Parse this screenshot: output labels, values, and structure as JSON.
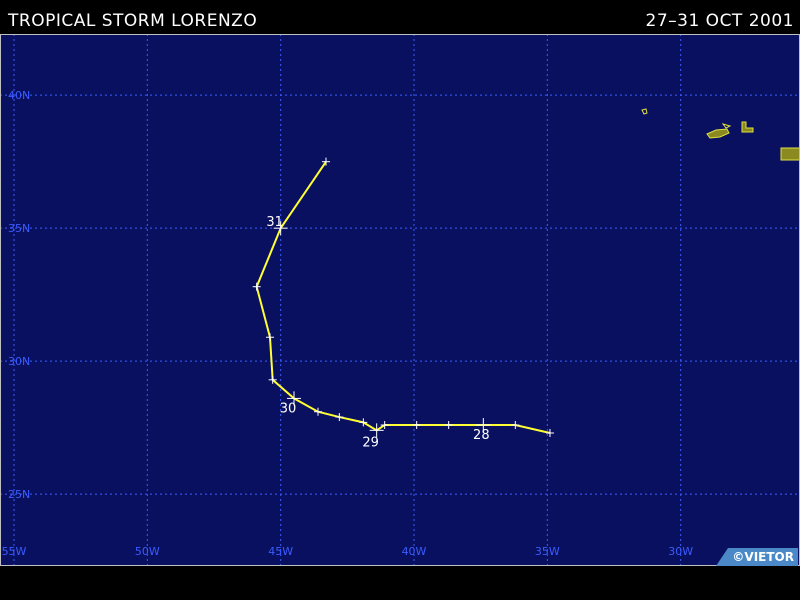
{
  "header": {
    "storm_name": "TROPICAL STORM LORENZO",
    "date_range": "27–31 OCT 2001"
  },
  "map": {
    "projection": "lat-lon",
    "lon_range": [
      -55,
      -25
    ],
    "lat_range": [
      22.3,
      42.3
    ],
    "background_color": "#0a1060",
    "grid_color": "#3a5cff",
    "track_color": "#ffff33",
    "land_color": "#8a8a20",
    "lat_labels": [
      {
        "lat": 40,
        "text": "40N"
      },
      {
        "lat": 35,
        "text": "35N"
      },
      {
        "lat": 30,
        "text": "30N"
      },
      {
        "lat": 25,
        "text": "25N"
      }
    ],
    "lon_labels": [
      {
        "lon": -55,
        "text": "55W"
      },
      {
        "lon": -50,
        "text": "50W"
      },
      {
        "lon": -45,
        "text": "45W"
      },
      {
        "lon": -40,
        "text": "40W"
      },
      {
        "lon": -35,
        "text": "35W"
      },
      {
        "lon": -30,
        "text": "30W"
      }
    ],
    "track": [
      {
        "lon": -34.9,
        "lat": 27.3
      },
      {
        "lon": -36.2,
        "lat": 27.6
      },
      {
        "lon": -37.4,
        "lat": 27.6,
        "day": "28"
      },
      {
        "lon": -38.7,
        "lat": 27.6
      },
      {
        "lon": -39.9,
        "lat": 27.6
      },
      {
        "lon": -41.1,
        "lat": 27.6
      },
      {
        "lon": -41.4,
        "lat": 27.4,
        "day": "29"
      },
      {
        "lon": -41.9,
        "lat": 27.7
      },
      {
        "lon": -42.8,
        "lat": 27.9
      },
      {
        "lon": -43.6,
        "lat": 28.1
      },
      {
        "lon": -44.5,
        "lat": 28.6,
        "day": "30"
      },
      {
        "lon": -45.3,
        "lat": 29.3
      },
      {
        "lon": -45.4,
        "lat": 30.9
      },
      {
        "lon": -45.9,
        "lat": 32.8
      },
      {
        "lon": -45.0,
        "lat": 35.0,
        "day": "31"
      },
      {
        "lon": -43.3,
        "lat": 37.5
      }
    ]
  },
  "copyright": {
    "text": "©VIETOR"
  }
}
